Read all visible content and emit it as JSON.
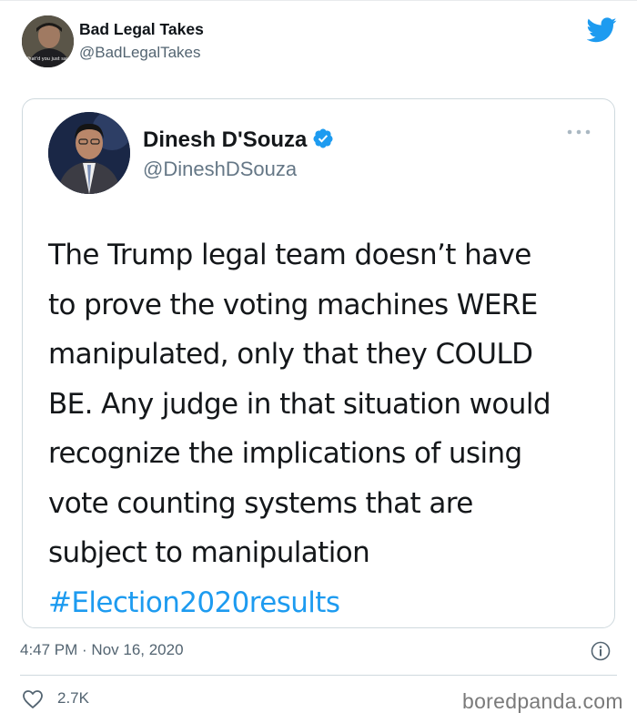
{
  "author": {
    "name": "Bad Legal Takes",
    "handle": "@BadLegalTakes",
    "avatar_caption": "What'd you just say?"
  },
  "quoted_tweet": {
    "name": "Dinesh D'Souza",
    "handle": "@DineshDSouza",
    "verified": true,
    "text_lines": [
      "The Trump legal team doesn’t have",
      "to prove the voting machines WERE",
      "manipulated, only that they COULD",
      "BE. Any judge in that situation would",
      "recognize the implications of using",
      "vote counting systems that are",
      "subject to manipulation"
    ],
    "hashtag": "#Election2020results"
  },
  "meta": {
    "timestamp": "4:47 PM · Nov 16, 2020",
    "likes": "2.7K"
  },
  "watermark": "boredpanda.com",
  "colors": {
    "twitter_blue": "#1d9bf0",
    "text": "#0f1419",
    "secondary_text": "#536471",
    "border": "#cfd9de"
  }
}
